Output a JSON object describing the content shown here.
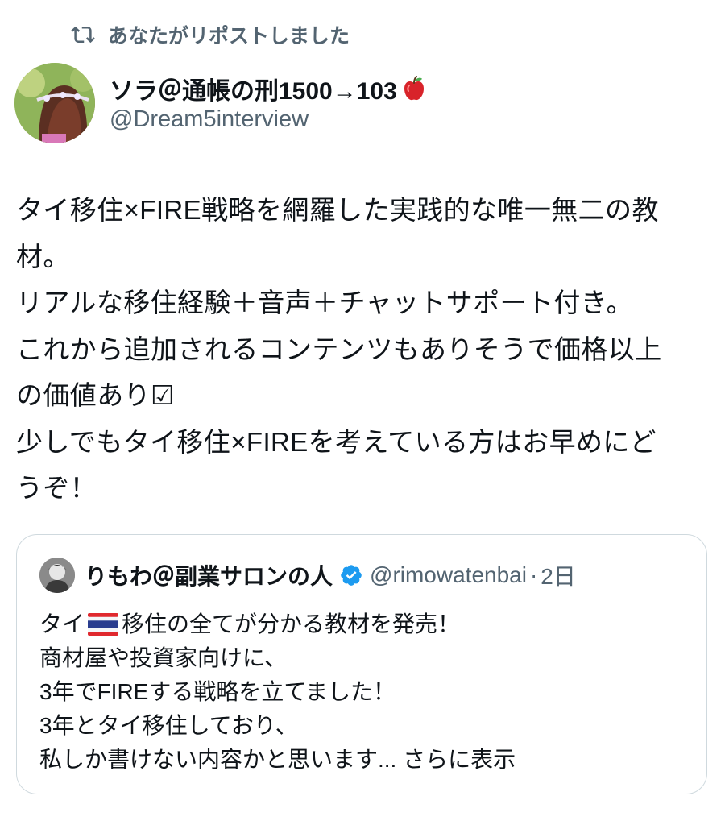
{
  "repost": {
    "icon": "repost-icon",
    "label": "あなたがリポストしました"
  },
  "author": {
    "display_name": "ソラ＠通帳の刑1500→103",
    "name_emoji": "apple-icon",
    "handle": "@Dream5interview",
    "avatar": "user-avatar"
  },
  "tweet": {
    "lines": [
      "タイ移住×FIRE戦略を網羅した実践的な唯一無二の教",
      "材。",
      "リアルな移住経験＋音声＋チャットサポート付き。",
      "これから追加されるコンテンツもありそうで価格以上",
      "の価値あり☑",
      "少しでもタイ移住×FIREを考えている方はお早めにど",
      "うぞ！"
    ]
  },
  "quote": {
    "avatar": "quoted-user-avatar",
    "display_name": "りもわ＠副業サロンの人",
    "verified_icon": "verified-badge-icon",
    "handle": "@rimowatenbai",
    "separator": "·",
    "time": "2日",
    "line1_before_flag": "タイ",
    "flag_icon": "thailand-flag-icon",
    "line1_after_flag": "移住の全てが分かる教材を発売！",
    "lines": [
      "商材屋や投資家向けに、",
      "3年でFIREする戦略を立てました！",
      "3年とタイ移住しており、"
    ],
    "last_line": "私しか書けない内容かと思います...",
    "show_more": "さらに表示"
  },
  "colors": {
    "text": "#0f1419",
    "secondary": "#536471",
    "border": "#cfd9de",
    "verified": "#1d9bf0"
  }
}
